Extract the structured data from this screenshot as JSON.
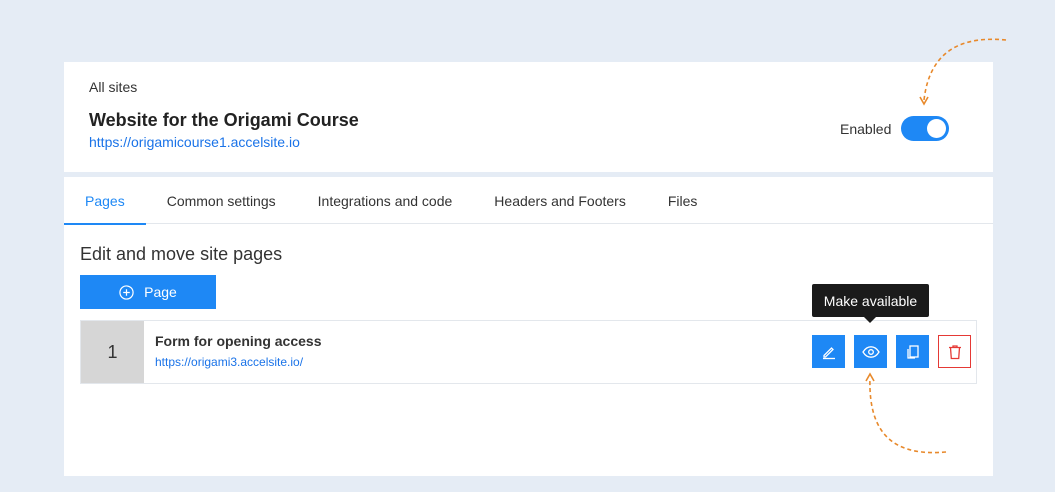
{
  "header": {
    "breadcrumb": "All sites",
    "site_title": "Website for the Origami Course",
    "site_url": "https://origamicourse1.accelsite.io",
    "enabled_label": "Enabled",
    "enabled": true
  },
  "tabs": [
    {
      "label": "Pages",
      "active": true
    },
    {
      "label": "Common settings"
    },
    {
      "label": "Integrations and code"
    },
    {
      "label": "Headers and Footers"
    },
    {
      "label": "Files"
    }
  ],
  "main": {
    "section_title": "Edit and move site pages",
    "add_page_label": "Page",
    "pages": [
      {
        "number": "1",
        "name": "Form for opening access",
        "url": "https://origami3.accelsite.io/"
      }
    ],
    "tooltip": "Make available"
  },
  "colors": {
    "accent": "#1e88f5",
    "danger": "#e53935",
    "annotation": "#e8892b"
  },
  "icons": [
    "plus-circle-icon",
    "pencil-icon",
    "eye-icon",
    "copy-icon",
    "trash-icon"
  ]
}
